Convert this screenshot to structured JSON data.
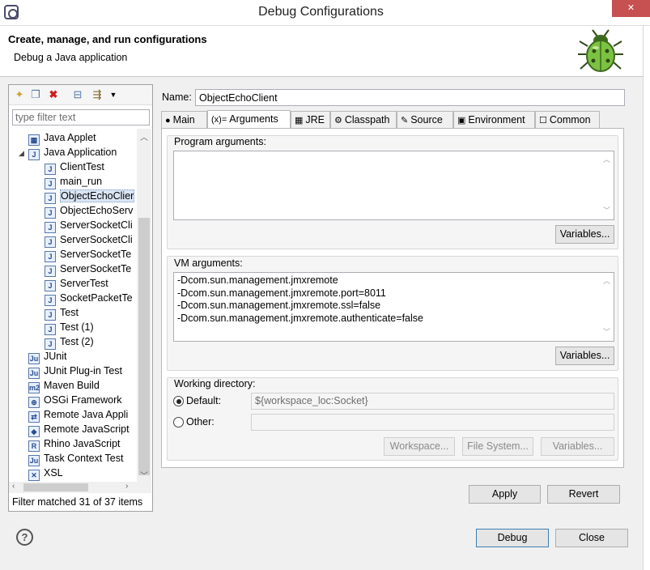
{
  "window": {
    "title": "Debug Configurations",
    "close": "✕"
  },
  "header": {
    "title": "Create, manage, and run configurations",
    "subtitle": "Debug a Java application"
  },
  "left": {
    "filter_placeholder": "type filter text",
    "status": "Filter matched 31 of 37 items",
    "tree": [
      {
        "label": "Java Applet",
        "icon": "java-applet-icon",
        "glyph": "▦",
        "level": 1
      },
      {
        "label": "Java Application",
        "icon": "java-application-icon",
        "glyph": "J",
        "level": 1,
        "expanded": true
      },
      {
        "label": "ClientTest",
        "icon": "java-launch-icon",
        "glyph": "J",
        "level": 2
      },
      {
        "label": "main_run",
        "icon": "java-launch-icon",
        "glyph": "J",
        "level": 2
      },
      {
        "label": "ObjectEchoClier",
        "icon": "java-launch-icon",
        "glyph": "J",
        "level": 2,
        "selected": true
      },
      {
        "label": "ObjectEchoServ",
        "icon": "java-launch-icon",
        "glyph": "J",
        "level": 2
      },
      {
        "label": "ServerSocketCli",
        "icon": "java-launch-icon",
        "glyph": "J",
        "level": 2
      },
      {
        "label": "ServerSocketCli",
        "icon": "java-launch-icon",
        "glyph": "J",
        "level": 2
      },
      {
        "label": "ServerSocketTe",
        "icon": "java-launch-icon",
        "glyph": "J",
        "level": 2
      },
      {
        "label": "ServerSocketTe",
        "icon": "java-launch-icon",
        "glyph": "J",
        "level": 2
      },
      {
        "label": "ServerTest",
        "icon": "java-launch-icon",
        "glyph": "J",
        "level": 2
      },
      {
        "label": "SocketPacketTe",
        "icon": "java-launch-icon",
        "glyph": "J",
        "level": 2
      },
      {
        "label": "Test",
        "icon": "java-launch-icon",
        "glyph": "J",
        "level": 2
      },
      {
        "label": "Test (1)",
        "icon": "java-launch-icon",
        "glyph": "J",
        "level": 2
      },
      {
        "label": "Test (2)",
        "icon": "java-launch-icon",
        "glyph": "J",
        "level": 2
      },
      {
        "label": "JUnit",
        "icon": "junit-icon",
        "glyph": "Ju",
        "level": 1
      },
      {
        "label": "JUnit Plug-in Test",
        "icon": "junit-plugin-icon",
        "glyph": "Ju",
        "level": 1
      },
      {
        "label": "Maven Build",
        "icon": "maven-icon",
        "glyph": "m2",
        "level": 1
      },
      {
        "label": "OSGi Framework",
        "icon": "osgi-icon",
        "glyph": "⊕",
        "level": 1
      },
      {
        "label": "Remote Java Appli",
        "icon": "remote-java-icon",
        "glyph": "⇄",
        "level": 1
      },
      {
        "label": "Remote JavaScript",
        "icon": "remote-javascript-icon",
        "glyph": "◆",
        "level": 1
      },
      {
        "label": "Rhino JavaScript",
        "icon": "rhino-icon",
        "glyph": "R",
        "level": 1
      },
      {
        "label": "Task Context Test",
        "icon": "task-context-icon",
        "glyph": "Ju",
        "level": 1
      },
      {
        "label": "XSL",
        "icon": "xsl-icon",
        "glyph": "✕",
        "level": 1
      }
    ]
  },
  "config": {
    "name_label": "Name:",
    "name_value": "ObjectEchoClient",
    "tabs": [
      {
        "label": "Main",
        "icon": "main-tab-icon",
        "glyph": "●"
      },
      {
        "label": "Arguments",
        "icon": "arguments-tab-icon",
        "glyph": "(x)=",
        "active": true
      },
      {
        "label": "JRE",
        "icon": "jre-tab-icon",
        "glyph": "▦"
      },
      {
        "label": "Classpath",
        "icon": "classpath-tab-icon",
        "glyph": "⚙"
      },
      {
        "label": "Source",
        "icon": "source-tab-icon",
        "glyph": "✎"
      },
      {
        "label": "Environment",
        "icon": "environment-tab-icon",
        "glyph": "▣"
      },
      {
        "label": "Common",
        "icon": "common-tab-icon",
        "glyph": "☐"
      }
    ],
    "program_args": {
      "label": "Program arguments:",
      "value": "",
      "variables": "Variables..."
    },
    "vm_args": {
      "label": "VM arguments:",
      "lines": [
        "-Dcom.sun.management.jmxremote",
        "-Dcom.sun.management.jmxremote.port=8011",
        "-Dcom.sun.management.jmxremote.ssl=false",
        "-Dcom.sun.management.jmxremote.authenticate=false"
      ],
      "variables": "Variables..."
    },
    "working_dir": {
      "label": "Working directory:",
      "default_label": "Default:",
      "default_value": "${workspace_loc:Socket}",
      "other_label": "Other:",
      "other_value": "",
      "workspace": "Workspace...",
      "file_system": "File System...",
      "variables": "Variables..."
    },
    "apply": "Apply",
    "revert": "Revert"
  },
  "footer": {
    "help": "?",
    "debug": "Debug",
    "close": "Close"
  }
}
